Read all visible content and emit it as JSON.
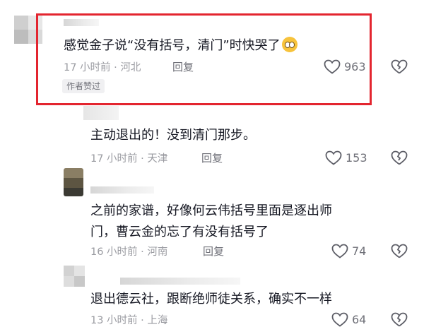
{
  "reply_label": "回复",
  "author_liked_label": "作者赞过",
  "comments": [
    {
      "text": "感觉金子说“没有括号，清门”时快哭了",
      "emoji": "pleading-face-emoji",
      "time_location": "17 小时前 · 河北",
      "likes": "963"
    },
    {
      "text": "主动退出的！没到清门那步。",
      "time_location": "17 小时前 · 天津",
      "likes": "153"
    },
    {
      "text_line1": "之前的家谱，好像何云伟括号里面是逐出师",
      "text_line2": "门，曹云金的忘了有没有括号了",
      "time_location": "16 小时前 · 河南",
      "likes": "74"
    },
    {
      "text": "退出德云社，跟断绝师徒关系，确实不一样",
      "time_location": "13 小时前 · 上海",
      "likes": "64"
    }
  ],
  "colors": {
    "highlight_border": "#e3252f",
    "text_primary": "#161823",
    "text_secondary": "#9a9ba1"
  }
}
